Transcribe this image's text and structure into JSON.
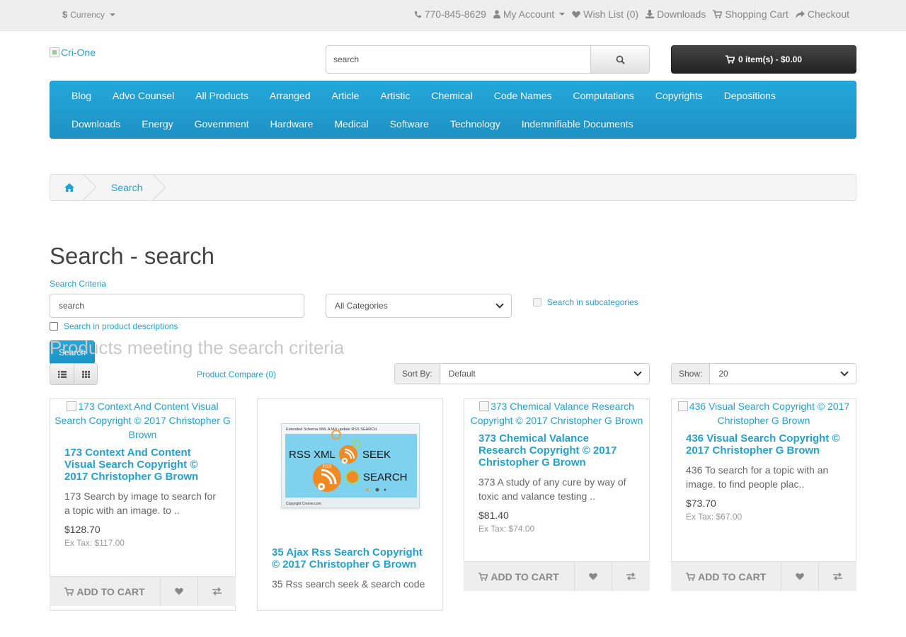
{
  "topbar": {
    "currency_label": "Currency",
    "phone": "770-845-8629",
    "my_account": "My Account",
    "wish_list": "Wish List (0)",
    "downloads": "Downloads",
    "shopping_cart": "Shopping Cart",
    "checkout": "Checkout"
  },
  "header": {
    "logo_alt": "Cri-One",
    "search_value": "search",
    "cart_label": "0 item(s) - $0.00"
  },
  "menu": {
    "items": [
      "Blog",
      "Advo Counsel",
      "All Products",
      "Arranged",
      "Article",
      "Artistic",
      "Chemical",
      "Code Names",
      "Computations",
      "Copyrights",
      "Depositions",
      "Downloads",
      "Energy",
      "Government",
      "Hardware",
      "Medical",
      "Software",
      "Technology",
      "Indemnifiable Documents"
    ]
  },
  "breadcrumb": {
    "current": "Search"
  },
  "page": {
    "title": "Search - search",
    "criteria_label": "Search Criteria",
    "criteria_value": "search",
    "category_selected": "All Categories",
    "subcategories_label": "Search in subcategories",
    "descriptions_label": "Search in product descriptions",
    "search_button": "Search",
    "results_title": "Products meeting the search criteria",
    "compare_link": "Product Compare (0)",
    "sort_label": "Sort By:",
    "sort_value": "Default",
    "show_label": "Show:",
    "show_value": "20"
  },
  "products": [
    {
      "img_alt": "173 Context And Content Visual Search Copyright © 2017 Christopher G Brown",
      "name": "173 Context And Content Visual Search Copyright © 2017 Christopher G Brown",
      "desc": "173 Search by image to search for a topic with an image. to ..",
      "price": "$128.70",
      "tax": "Ex Tax: $117.00",
      "add_to_cart": "Add to Cart"
    },
    {
      "img_caption": "Extended Schema XML AJAX update RSS SEARCH",
      "img_rss_xml": "RSS XML",
      "img_seek": "SEEK",
      "img_search": "SEARCH",
      "img_rss": "RSS",
      "img_footer": "Copyright Crioner.com",
      "name": "35 Ajax Rss Search Copyright © 2017 Christopher G Brown",
      "desc": "35 Rss search seek & search code"
    },
    {
      "img_alt": "373 Chemical Valance Research Copyright © 2017 Christopher G Brown",
      "name": "373 Chemical Valance Research Copyright © 2017 Christopher G Brown",
      "desc": "373 A study of any cure by way of toxic and valance testing ..",
      "price": "$81.40",
      "tax": "Ex Tax: $74.00",
      "add_to_cart": "Add to Cart"
    },
    {
      "img_alt": "436 Visual Search Copyright © 2017 Christopher G Brown",
      "name": "436 Visual Search Copyright © 2017 Christopher G Brown",
      "desc": "436 To search for a topic with an image. to find people plac..",
      "price": "$73.70",
      "tax": "Ex Tax: $67.00",
      "add_to_cart": "Add to Cart"
    }
  ],
  "colors": {
    "accent": "#23a1d1",
    "menu_bg": "#229ac8",
    "cart_bg": "#303030"
  }
}
